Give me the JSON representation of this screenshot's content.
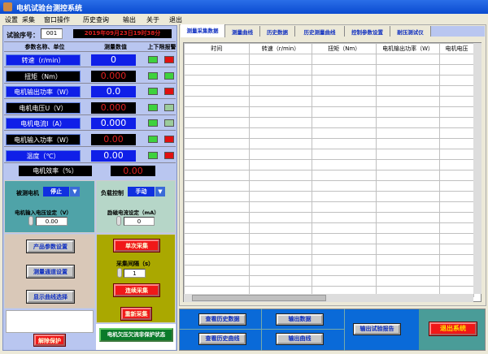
{
  "window": {
    "title": "电机试验台测控系统"
  },
  "menu": [
    "设置",
    "采集",
    "窗口操作",
    "历史查询",
    "输出",
    "关于",
    "退出"
  ],
  "test": {
    "label": "试验序号：",
    "number": "001",
    "datetime": "2019年09月23日19时38分"
  },
  "params_header": {
    "name": "参数名称、单位",
    "value": "测量数值",
    "alarm": "上下限报警"
  },
  "params": [
    {
      "name": "转速（r/min）",
      "value": "0",
      "style": "blue",
      "leds": [
        "green",
        "red"
      ]
    },
    {
      "name": "扭矩（Nm）",
      "value": "0.000",
      "style": "black",
      "leds": [
        "green",
        "green"
      ]
    },
    {
      "name": "电机输出功率（W）",
      "value": "0.0",
      "style": "blue",
      "leds": [
        "green",
        "red"
      ]
    },
    {
      "name": "电机电压U（V）",
      "value": "0.000",
      "style": "black",
      "leds": [
        "green",
        "lightgreen"
      ]
    },
    {
      "name": "电机电流I（A）",
      "value": "0.000",
      "style": "blue",
      "leds": [
        "green",
        "lightgreen"
      ]
    },
    {
      "name": "电机输入功率（W）",
      "value": "0.00",
      "style": "black",
      "leds": [
        "green",
        "red"
      ]
    },
    {
      "name": "温度（℃）",
      "value": "0.00",
      "style": "blue",
      "leds": [
        "green",
        "red"
      ]
    }
  ],
  "efficiency": {
    "name": "电机效率（%）",
    "value": "0.00"
  },
  "motor": {
    "label": "被测电机",
    "select": "停止",
    "voltage_label": "电机输入电压设定（V）",
    "voltage": "0.00"
  },
  "load": {
    "label": "负载控制",
    "select": "手动",
    "current_label": "励磁电流设定（mA）",
    "current": "0"
  },
  "left_buttons": [
    "产品参数设置",
    "测量通道设置",
    "显示曲线选择"
  ],
  "acq": {
    "single": "单次采集",
    "interval_label": "采集间隔（s）",
    "interval": "1",
    "continuous": "连续采集",
    "restart": "重新采集"
  },
  "protect": {
    "release": "解除保护",
    "status": "电机欠压欠流非保护状态"
  },
  "tabs": [
    "测量采集数据",
    "测量曲线",
    "历史数据",
    "历史测量曲线",
    "控制参数设置",
    "耐压测试仪"
  ],
  "table": {
    "columns": [
      "时间",
      "转速（r/min）",
      "扭矩（Nm）",
      "电机输出功率（W）",
      "电机电压"
    ]
  },
  "bottom": {
    "view_history_data": "查看历史数据",
    "view_history_curve": "查看历史曲线",
    "export_data": "输出数据",
    "export_curve": "输出曲线",
    "export_report": "输出试验报告",
    "exit": "退出系统"
  }
}
